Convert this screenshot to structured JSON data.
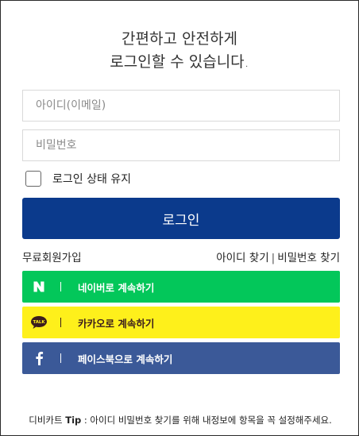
{
  "headline": {
    "line1": "간편하고 안전하게",
    "line2": "로그인할 수 있습니다."
  },
  "form": {
    "userid_placeholder": "아이디(이메일)",
    "password_placeholder": "비밀번호",
    "keep_login_label": "로그인 상태 유지",
    "keep_login_checked": false,
    "login_button_label": "로그인"
  },
  "links": {
    "signup": "무료회원가입",
    "find_id": "아이디 찾기",
    "separator": "|",
    "find_password": "비밀번호 찾기"
  },
  "social": [
    {
      "label": "네이버로 계속하기",
      "icon": "naver-n-icon",
      "color": "#03c75a"
    },
    {
      "label": "카카오로 계속하기",
      "icon": "kakao-talk-icon",
      "color": "#fef01b"
    },
    {
      "label": "페이스북으로 계속하기",
      "icon": "facebook-f-icon",
      "color": "#3b5998"
    }
  ],
  "tip": {
    "prefix": "디비카트",
    "tip_label": "Tip",
    "text": " : 아이디 비밀번호 찾기를 위해 내정보에 항목을 꼭 설정해주세요."
  },
  "colors": {
    "login_button": "#0b3a8c",
    "naver": "#03c75a",
    "kakao": "#fef01b",
    "facebook": "#3b5998"
  }
}
